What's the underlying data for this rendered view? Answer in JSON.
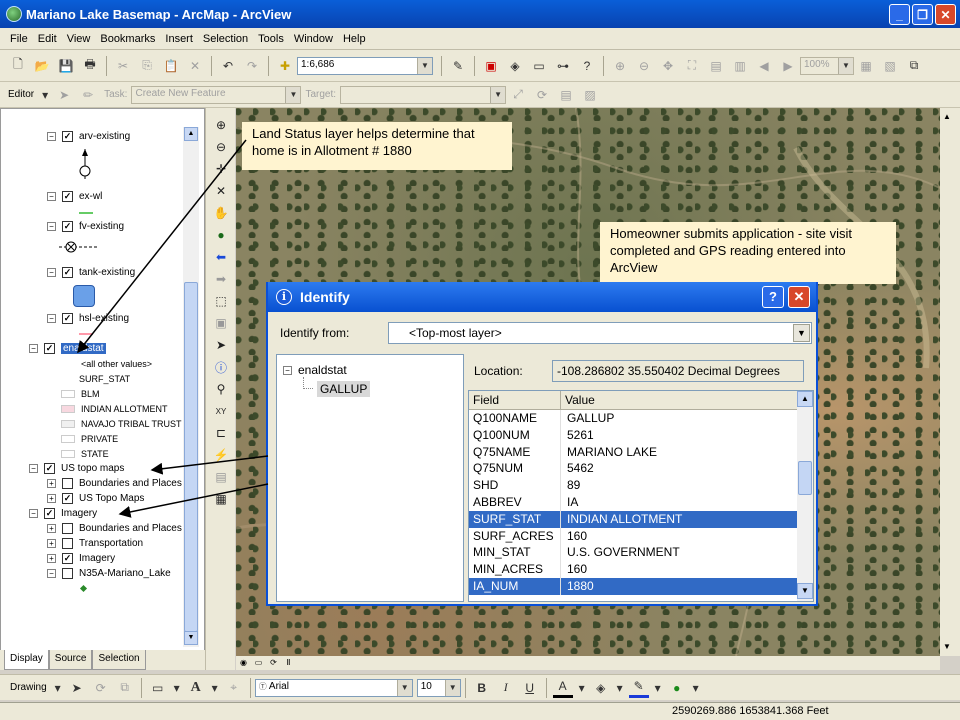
{
  "window": {
    "title": "Mariano Lake Basemap - ArcMap - ArcView"
  },
  "menu": [
    "File",
    "Edit",
    "View",
    "Bookmarks",
    "Insert",
    "Selection",
    "Tools",
    "Window",
    "Help"
  ],
  "toolbar": {
    "scale": "1:6,686",
    "zoom": "100%",
    "editor_label": "Editor",
    "task_label": "Task:",
    "task_value": "Create New Feature",
    "target_label": "Target:"
  },
  "toc": {
    "layers": [
      {
        "label": "arv-existing"
      },
      {
        "label": "ex-wl"
      },
      {
        "label": "fv-existing"
      },
      {
        "label": "tank-existing"
      },
      {
        "label": "hsl-existing"
      }
    ],
    "enaldstat": {
      "label": "enaldstat",
      "legend_header": "<all other values>",
      "field": "SURF_STAT",
      "values": [
        "BLM",
        "INDIAN ALLOTMENT",
        "NAVAJO TRIBAL TRUST",
        "PRIVATE",
        "STATE"
      ],
      "colors": [
        "#ffffff",
        "#f8d8e0",
        "#f0f0f0",
        "#ffffff",
        "#ffffff"
      ]
    },
    "us_topo": {
      "label": "US topo maps",
      "children": [
        "Boundaries and Places",
        "US Topo Maps"
      ]
    },
    "imagery": {
      "label": "Imagery",
      "children": [
        "Boundaries and Places",
        "Transportation",
        "Imagery",
        "N35A-Mariano_Lake"
      ]
    },
    "tabs": [
      "Display",
      "Source",
      "Selection"
    ]
  },
  "callouts": {
    "land_status": "Land Status layer helps determine that home is in Allotment # 1880",
    "homeowner": "Homeowner submits application - site visit completed and GPS reading entered into ArcView"
  },
  "identify": {
    "title": "Identify",
    "help_label": "?",
    "close_label": "✕",
    "from_label": "Identify from:",
    "from_value": "<Top-most layer>",
    "tree_root": "enaldstat",
    "tree_child": "GALLUP",
    "location_label": "Location:",
    "location_value": "-108.286802  35.550402 Decimal Degrees",
    "columns": [
      "Field",
      "Value"
    ],
    "rows": [
      {
        "field": "Q100NAME",
        "value": "GALLUP"
      },
      {
        "field": "Q100NUM",
        "value": "5261"
      },
      {
        "field": "Q75NAME",
        "value": "MARIANO LAKE"
      },
      {
        "field": "Q75NUM",
        "value": "5462"
      },
      {
        "field": "SHD",
        "value": "89"
      },
      {
        "field": "ABBREV",
        "value": "IA"
      },
      {
        "field": "SURF_STAT",
        "value": "INDIAN ALLOTMENT"
      },
      {
        "field": "SURF_ACRES",
        "value": "160"
      },
      {
        "field": "MIN_STAT",
        "value": "U.S. GOVERNMENT"
      },
      {
        "field": "MIN_ACRES",
        "value": "160"
      },
      {
        "field": "IA_NUM",
        "value": "1880"
      }
    ],
    "selected_rows": [
      6,
      10
    ]
  },
  "drawing": {
    "label": "Drawing",
    "font": "Arial",
    "font_size": "10",
    "bold": "B",
    "italic": "I",
    "underline": "U"
  },
  "status": {
    "coords": "2590269.886  1653841.368 Feet"
  }
}
